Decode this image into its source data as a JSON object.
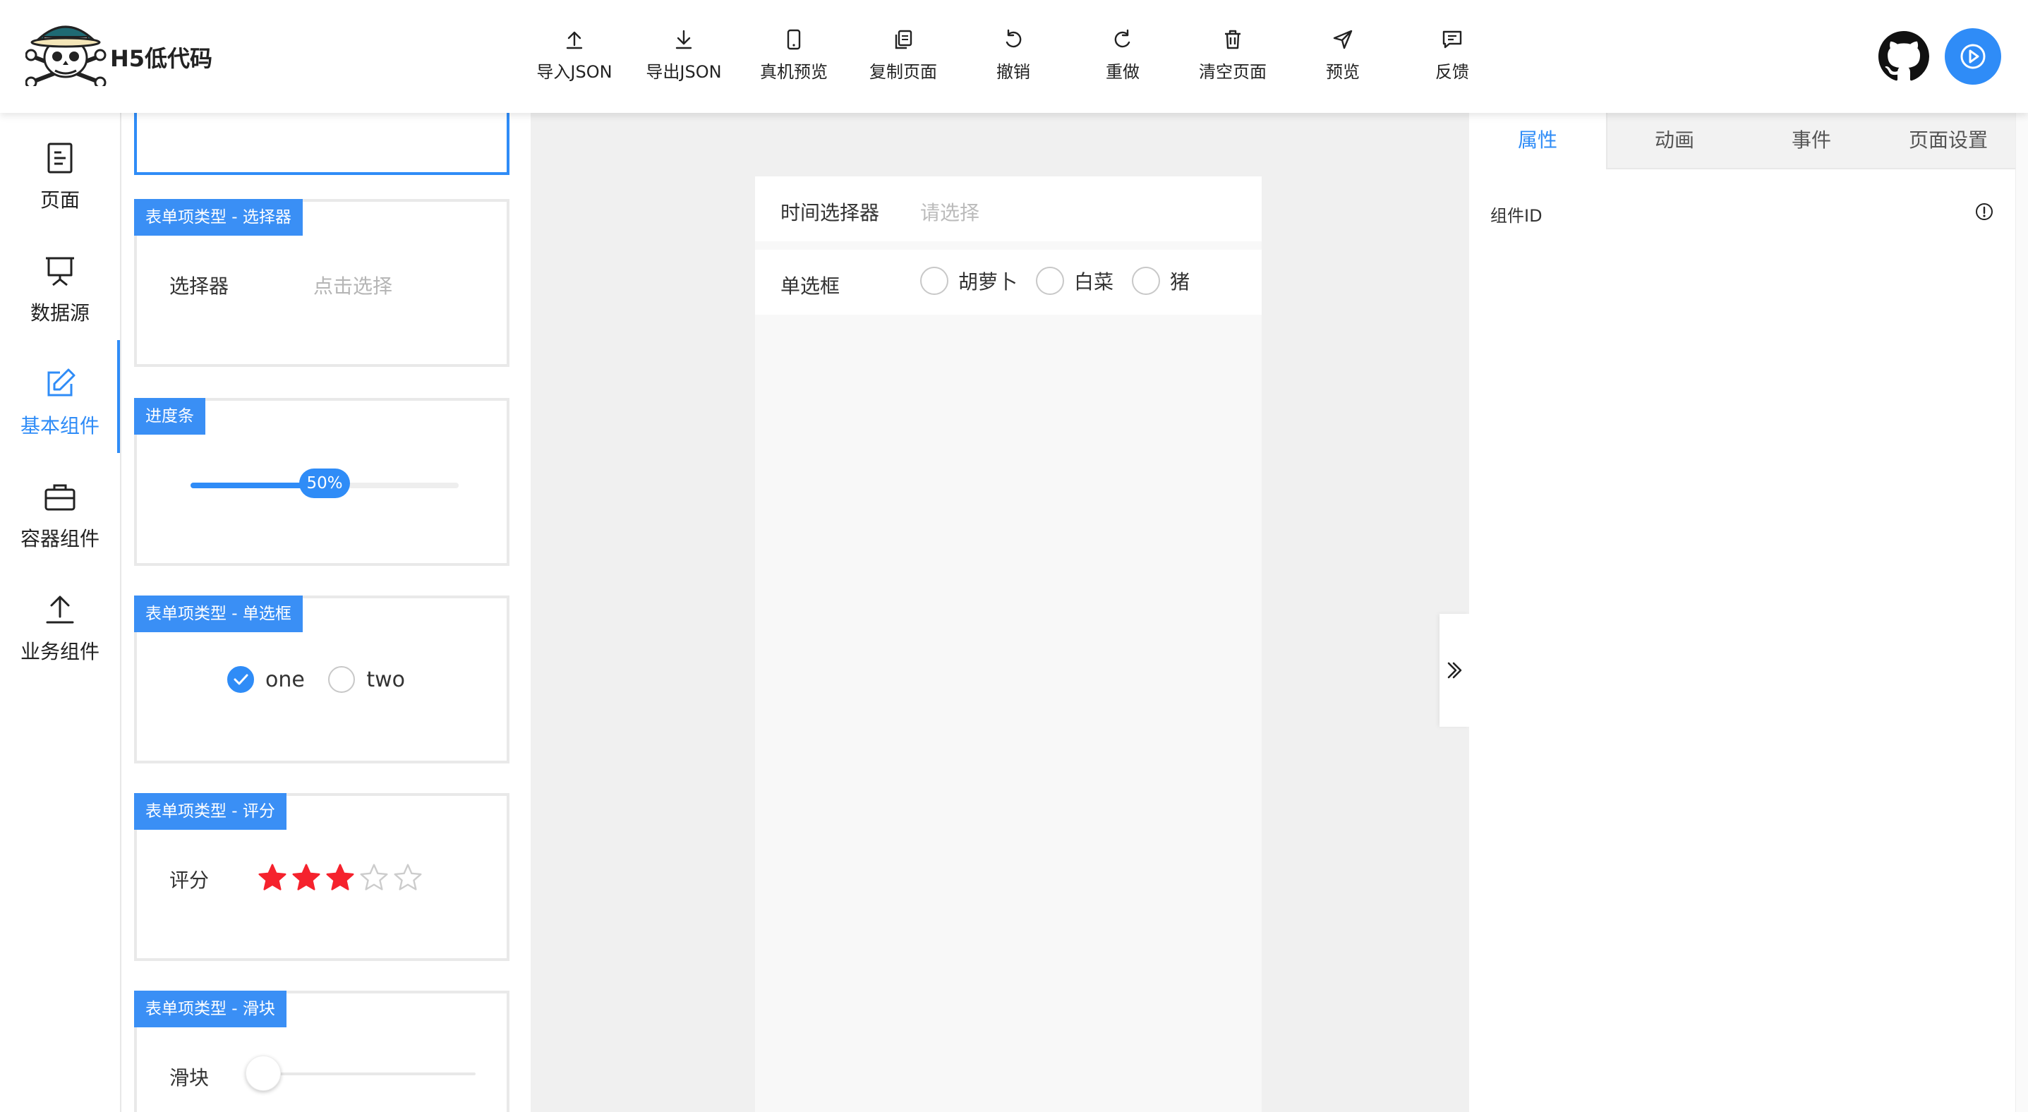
{
  "header": {
    "app_title": "H5低代码",
    "logo_icon": "skull-logo-icon",
    "toolbar": [
      {
        "label": "导入JSON",
        "icon": "upload-icon"
      },
      {
        "label": "导出JSON",
        "icon": "download-icon"
      },
      {
        "label": "真机预览",
        "icon": "mobile-icon"
      },
      {
        "label": "复制页面",
        "icon": "copy-icon"
      },
      {
        "label": "撤销",
        "icon": "undo-icon"
      },
      {
        "label": "重做",
        "icon": "redo-icon"
      },
      {
        "label": "清空页面",
        "icon": "trash-icon"
      },
      {
        "label": "预览",
        "icon": "send-icon"
      },
      {
        "label": "反馈",
        "icon": "feedback-icon"
      }
    ],
    "github_icon": "github-icon",
    "run_icon": "play-circle-icon"
  },
  "leftnav": {
    "items": [
      {
        "label": "页面",
        "icon": "page-icon"
      },
      {
        "label": "数据源",
        "icon": "presentation-icon"
      },
      {
        "label": "基本组件",
        "icon": "edit-icon",
        "active": true
      },
      {
        "label": "容器组件",
        "icon": "briefcase-icon"
      },
      {
        "label": "业务组件",
        "icon": "upload-icon"
      }
    ]
  },
  "components": {
    "picker": {
      "tag": "表单项类型 - 选择器",
      "label": "选择器",
      "placeholder": "点击选择"
    },
    "progress": {
      "tag": "进度条",
      "percent": 50,
      "percent_label": "50%"
    },
    "radio": {
      "tag": "表单项类型 - 单选框",
      "options": [
        "one",
        "two"
      ],
      "selected": "one"
    },
    "rate": {
      "tag": "表单项类型 - 评分",
      "label": "评分",
      "value": 3,
      "max": 5
    },
    "slider": {
      "tag": "表单项类型 - 滑块",
      "label": "滑块",
      "value": 0
    }
  },
  "canvas": {
    "time_picker": {
      "label": "时间选择器",
      "placeholder": "请选择"
    },
    "radio_row": {
      "label": "单选框",
      "options": [
        "胡萝卜",
        "白菜",
        "猪"
      ]
    },
    "collapse_icon": "double-chevron-right-icon"
  },
  "right_panel": {
    "tabs": [
      "属性",
      "动画",
      "事件",
      "页面设置"
    ],
    "active_tab": "属性",
    "field_label": "组件ID",
    "info_icon": "info-circle-icon"
  },
  "colors": {
    "accent": "#2f8cf7",
    "star_active": "#f5222d",
    "star_inactive": "#cccccc"
  }
}
